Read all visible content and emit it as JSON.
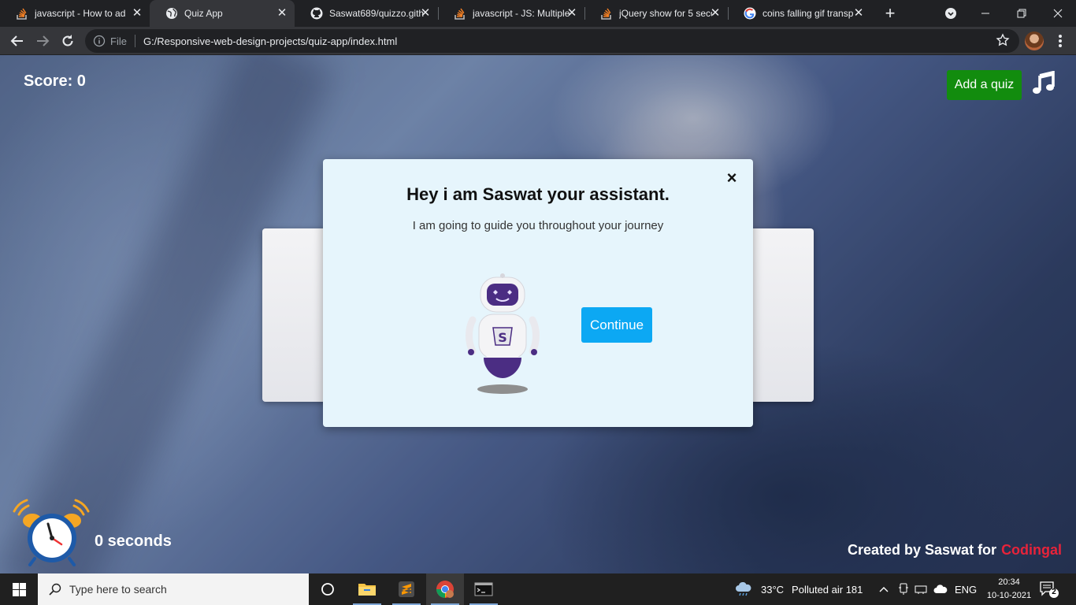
{
  "browser": {
    "tabs": [
      {
        "title": "javascript - How to ad",
        "favicon": "stackoverflow-icon",
        "active": false
      },
      {
        "title": "Quiz App",
        "favicon": "globe-icon",
        "active": true
      },
      {
        "title": "Saswat689/quizzo.gith",
        "favicon": "github-icon",
        "active": false
      },
      {
        "title": "javascript - JS: Multiple",
        "favicon": "stackoverflow-icon",
        "active": false
      },
      {
        "title": "jQuery show for 5 seco",
        "favicon": "stackoverflow-icon",
        "active": false
      },
      {
        "title": "coins falling gif transp",
        "favicon": "google-icon",
        "active": false
      }
    ],
    "omnibox": {
      "scheme_label": "File",
      "url": "G:/Responsive-web-design-projects/quiz-app/index.html"
    }
  },
  "page": {
    "score_label": "Score: 0",
    "add_quiz_label": "Add a quiz",
    "timer_text": "0 seconds",
    "credit_text": "Created by Saswat for",
    "credit_brand": "Codingal",
    "brand_color": "#e7233a"
  },
  "modal": {
    "title": "Hey i am Saswat your assistant.",
    "subtitle": "I am going to guide you throughout your journey",
    "close_glyph": "×",
    "continue_label": "Continue",
    "button_color": "#0ca8f3"
  },
  "taskbar": {
    "search_placeholder": "Type here to search",
    "weather": "33°C",
    "air": "Polluted air 181",
    "language": "ENG",
    "time": "20:34",
    "date": "10-10-2021",
    "notification_count": "2"
  }
}
